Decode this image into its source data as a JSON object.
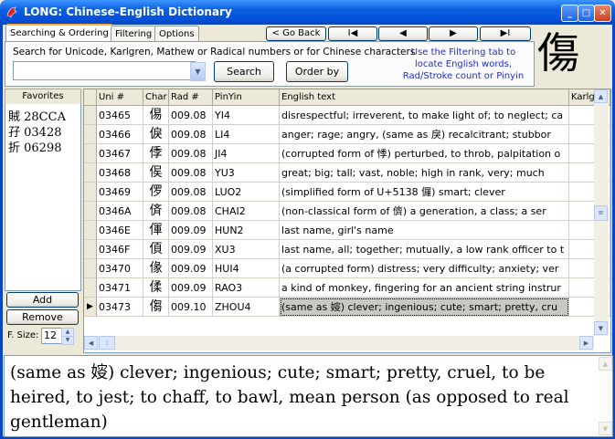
{
  "window": {
    "title": "LONG: Chinese-English Dictionary"
  },
  "tabs": [
    {
      "label": "Searching & Ordering"
    },
    {
      "label": "Filtering"
    },
    {
      "label": "Options"
    }
  ],
  "nav": {
    "go_back": "< Go Back",
    "first": "I◀",
    "prev": "◀",
    "next": "▶",
    "last": "▶I"
  },
  "search": {
    "label": "Search for Unicode, Karlgren, Mathew or Radical numbers or for Chinese characters",
    "value": "",
    "search_button": "Search",
    "order_button": "Order by",
    "hint": "Use the Filtering tab to locate English words, Rad/Stroke count or Pinyin"
  },
  "big_char": "傷",
  "favorites": {
    "header": "Favorites",
    "items": [
      "賊 28CCA",
      "孖 03428",
      "折 06298"
    ],
    "add": "Add",
    "remove": "Remove",
    "fsize_label": "F. Size:",
    "fsize_value": "12"
  },
  "grid": {
    "columns": [
      "Uni #",
      "Char",
      "Rad #",
      "PinYin",
      "English text",
      "Karlg"
    ],
    "rows": [
      [
        "03465",
        "㑥",
        "009.08",
        "YI4",
        "disrespectful; irreverent, to make light of; to neglect; ca"
      ],
      [
        "03466",
        "㑦",
        "009.08",
        "LI4",
        "anger; rage; angry, (same as 戾) recalcitrant; stubbor"
      ],
      [
        "03467",
        "㑧",
        "009.08",
        "JI4",
        "(corrupted form of 悸) perturbed, to throb, palpitation o"
      ],
      [
        "03468",
        "㑨",
        "009.08",
        "YU3",
        "great; big; tall; vast, noble; high in rank, very; much"
      ],
      [
        "03469",
        "㑩",
        "009.08",
        "LUO2",
        "(simplified form of U+5138 儸) smart; clever"
      ],
      [
        "0346A",
        "㑪",
        "009.08",
        "CHAI2",
        "(non-classical form of 儕) a generation, a class; a ser"
      ],
      [
        "0346E",
        "㑮",
        "009.09",
        "HUN2",
        "last name, girl's name"
      ],
      [
        "0346F",
        "㑯",
        "009.09",
        "XU3",
        "last name, all; together; mutually, a low rank officer to t"
      ],
      [
        "03470",
        "㑰",
        "009.09",
        "HUI4",
        "(a corrupted form) distress; very difficulty; anxiety; ver"
      ],
      [
        "03471",
        "㑱",
        "009.09",
        "RAO3",
        "a kind of monkey, fingering for an ancient string instrur"
      ],
      [
        "03473",
        "㑳",
        "009.10",
        "ZHOU4",
        "(same as 㛮) clever; ingenious; cute; smart; pretty, cru"
      ]
    ],
    "selected_index": 10
  },
  "detail": {
    "text": "(same as 㛮) clever; ingenious; cute; smart; pretty, cruel, to be heired, to jest; to chaff, to bawl, mean person (as opposed to real gentleman)"
  }
}
